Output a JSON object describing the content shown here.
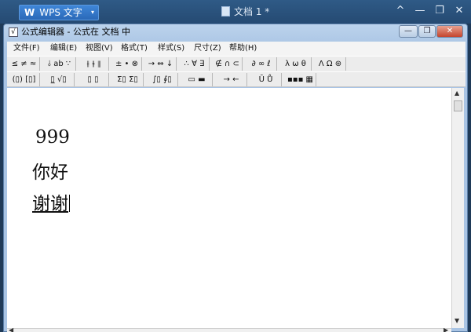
{
  "wps": {
    "app_label": "WPS 文字",
    "app_icon": "W",
    "doc_title": "文档 1 *",
    "controls": [
      "^",
      "—",
      "❐",
      "✕"
    ]
  },
  "editor": {
    "title": "公式编辑器 - 公式在 文档  中",
    "window_controls": [
      "—",
      "❐",
      "✕"
    ]
  },
  "menu": [
    "文件(F)",
    "编辑(E)",
    "视图(V)",
    "格式(T)",
    "样式(S)",
    "尺寸(Z)",
    "帮助(H)"
  ],
  "toolbar_row1": [
    "≤ ≠ ≈",
    "⫰ ab ∵",
    "⫲ ⫳ ⫴",
    "± • ⊗",
    "→ ⇔ ↓",
    "∴ ∀ ∃",
    "∉ ∩ ⊂",
    "∂ ∞ ℓ",
    "λ ω θ",
    "Λ Ω ⊛"
  ],
  "toolbar_row2": [
    "(▯) [▯]",
    "▯̲ √▯",
    "▯ ▯",
    "Σ▯ Σ▯",
    "∫▯ ∮▯",
    "▭ ▬",
    "→ ←",
    "Ū Ů",
    "▪▪▪ ▦"
  ],
  "document": {
    "lines": [
      "999",
      "你好",
      "谢谢"
    ]
  }
}
